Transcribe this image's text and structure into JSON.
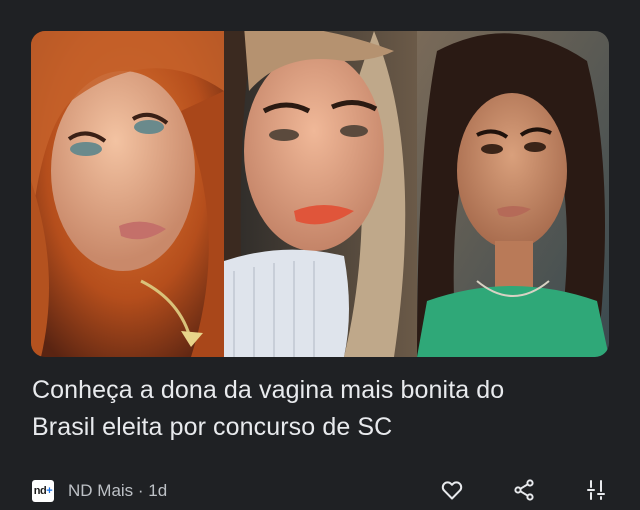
{
  "article": {
    "headline_line1": "Conheça a dona da vagina mais bonita do",
    "headline_line2": "Brasil eleita por concurso de SC",
    "image_alt": "Three portrait photos of women"
  },
  "source": {
    "logo_text": "nd",
    "logo_plus": "+",
    "name": "ND Mais",
    "separator": " · ",
    "age": "1d"
  },
  "actions": {
    "like_icon": "heart-icon",
    "share_icon": "share-icon",
    "more_icon": "tune-icon"
  },
  "colors": {
    "background": "#1f2124",
    "text": "#e8eaed",
    "meta": "#bdc1c6",
    "icon": "#e8eaed"
  }
}
